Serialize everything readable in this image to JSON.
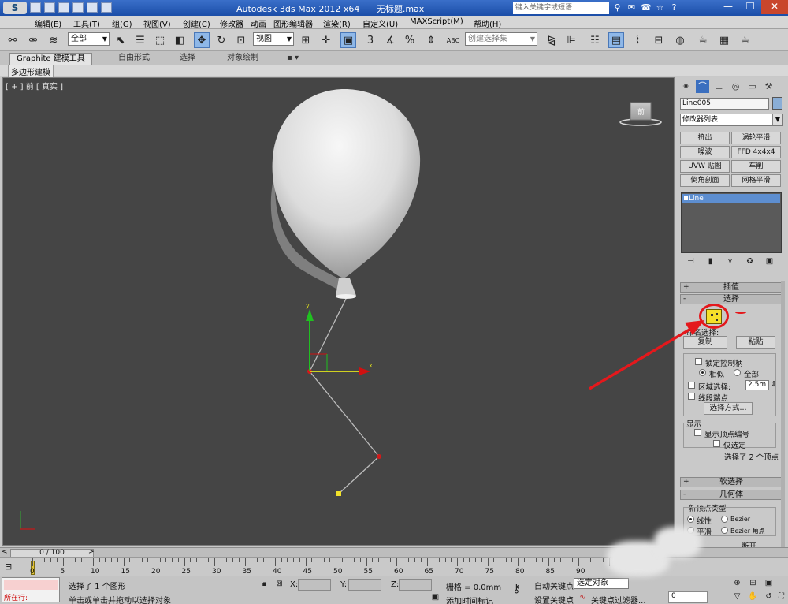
{
  "titlebar": {
    "logo": "S",
    "app_title": "Autodesk 3ds Max  2012 x64",
    "file_title": "无标题.max",
    "search_placeholder": "键入关键字或短语"
  },
  "menu": [
    "编辑(E)",
    "工具(T)",
    "组(G)",
    "视图(V)",
    "创建(C)",
    "修改器",
    "动画",
    "图形编辑器",
    "渲染(R)",
    "自定义(U)",
    "MAXScript(M)",
    "帮助(H)"
  ],
  "toolbar": {
    "filter_value": "全部",
    "refcoord_value": "视图",
    "selset_placeholder": "创建选择集",
    "snap_3": "3",
    "snap_pct": "%",
    "snap_abc": "ABC"
  },
  "ribbon": {
    "tabs": [
      "Graphite 建模工具",
      "自由形式",
      "选择",
      "对象绘制"
    ],
    "sub_label": "多边形建模"
  },
  "viewport": {
    "label": "[ + ] 前 [ 真实 ]",
    "gizmo_y": "y",
    "gizmo_x": "x",
    "viewcube": "前"
  },
  "command_panel": {
    "object_name": "Line005",
    "modifier_list": "修改器列表",
    "modifier_buttons": [
      "挤出",
      "涡轮平滑",
      "噪波",
      "FFD 4x4x4",
      "UVW 贴图",
      "车削",
      "倒角剖面",
      "网格平滑"
    ],
    "stack_item": "Line",
    "rollouts": {
      "interp": "插值",
      "select": "选择",
      "soft": "软选择",
      "geometry": "几何体"
    },
    "named_selection": "命名选择:",
    "copy": "复制",
    "paste": "粘贴",
    "lock_handles": "锁定控制柄",
    "alike": "相似",
    "all": "全部",
    "area_select": "区域选择:",
    "area_value": "2.5m",
    "segment_end": "线段端点",
    "select_by": "选择方式...",
    "display": "显示",
    "show_vertex_numbers": "显示顶点编号",
    "selected_only": "仅选定",
    "selected_count": "选择了 2 个顶点",
    "new_vertex_type": "新顶点类型",
    "linear": "线性",
    "bezier": "Bezier",
    "smooth": "平滑",
    "bezier_corner": "Bezier 角点",
    "break_partial": "断开"
  },
  "timeline": {
    "frame_counter": "0 / 100",
    "ticks": [
      "0",
      "5",
      "10",
      "15",
      "20",
      "25",
      "30",
      "35",
      "40",
      "45",
      "50",
      "55",
      "60",
      "65",
      "70",
      "75",
      "80",
      "85",
      "90"
    ]
  },
  "statusbar": {
    "script_label": "所在行:",
    "selection_status": "选择了 1 个图形",
    "prompt": "单击或单击并拖动以选择对象",
    "x_label": "X:",
    "y_label": "Y:",
    "z_label": "Z:",
    "grid": "栅格 = 0.0mm",
    "add_time_tag": "添加时间标记",
    "auto_key": "自动关键点",
    "selected_object": "选定对象",
    "set_key": "设置关键点",
    "key_filters": "关键点过滤器...",
    "frame": "0"
  },
  "colors": {
    "title_blue": "#1b4ea8",
    "viewport_bg": "#454545",
    "annotation_red": "#e4181c",
    "stack_highlight": "#5d8ed0",
    "vertex_yellow": "#f5e02a"
  }
}
